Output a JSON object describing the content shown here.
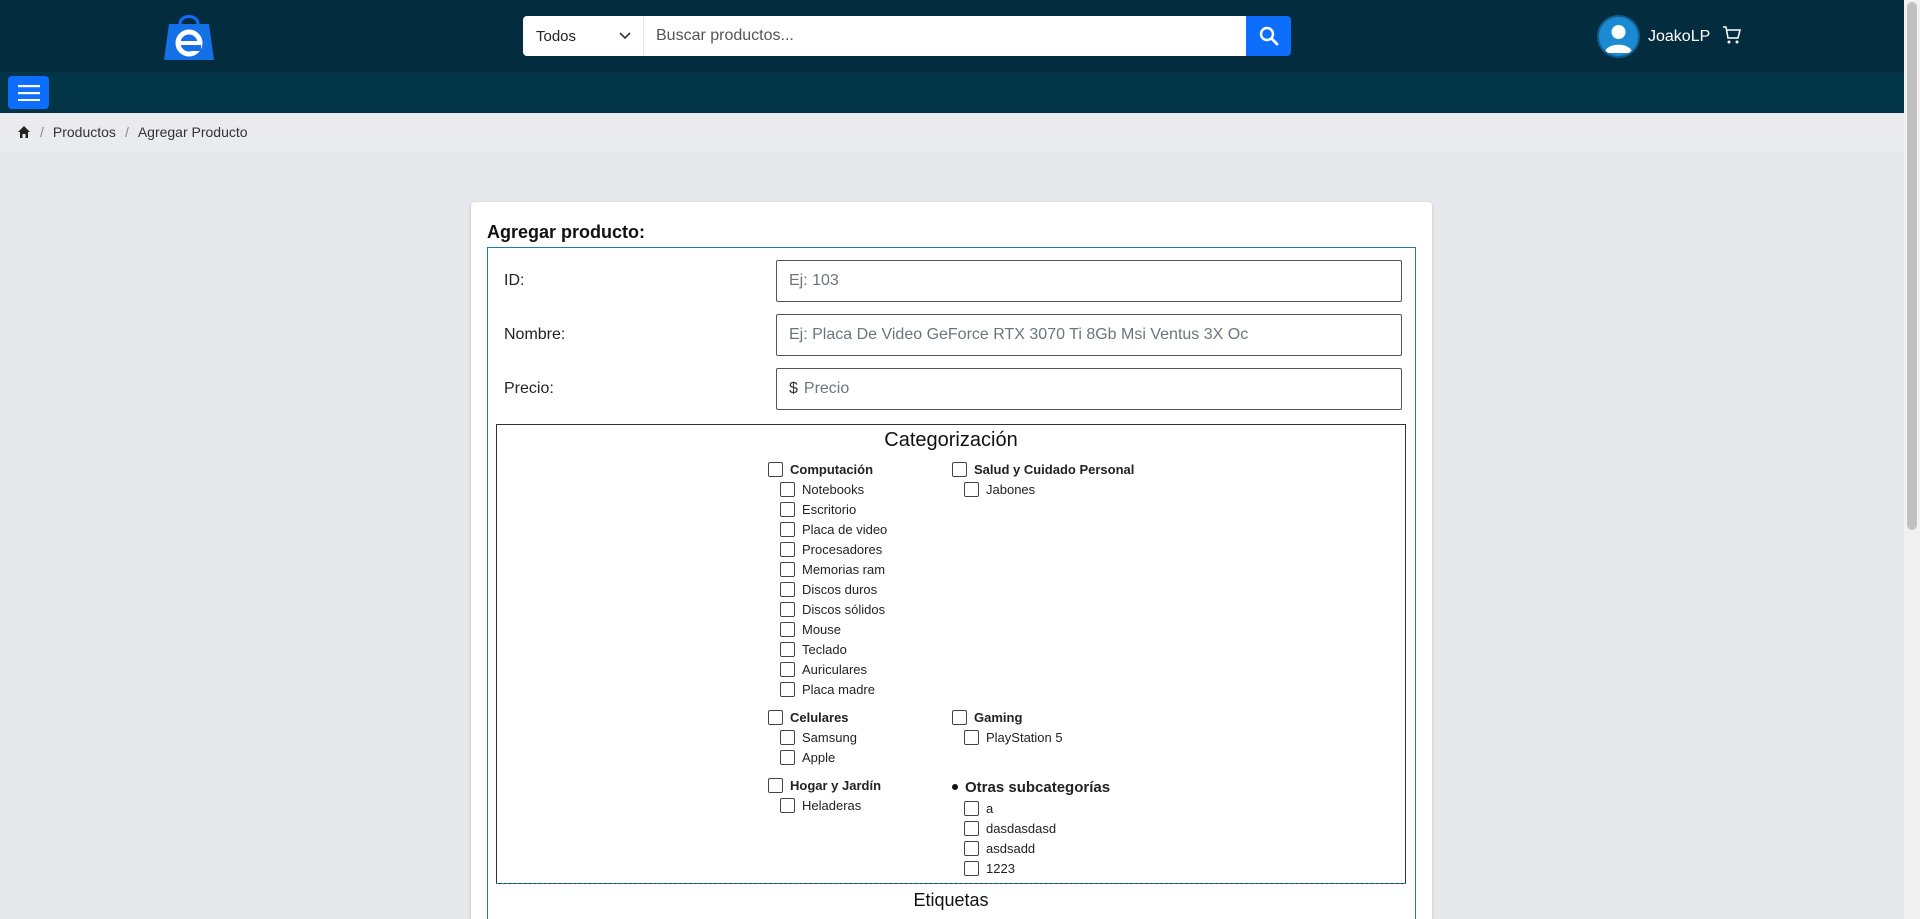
{
  "header": {
    "search_category": "Todos",
    "search_placeholder": "Buscar productos...",
    "username": "JoakoLP"
  },
  "breadcrumb": {
    "items": [
      "Productos",
      "Agregar Producto"
    ]
  },
  "form": {
    "title": "Agregar producto:",
    "id_label": "ID:",
    "id_placeholder": "Ej: 103",
    "name_label": "Nombre:",
    "name_placeholder": "Ej: Placa De Video GeForce RTX 3070 Ti 8Gb Msi Ventus 3X Oc",
    "price_label": "Precio:",
    "price_prefix": "$",
    "price_placeholder": "Precio",
    "categorization_title": "Categorización",
    "tags_title": "Etiquetas"
  },
  "categories": {
    "computacion": {
      "label": "Computación",
      "children": [
        "Notebooks",
        "Escritorio",
        "Placa de video",
        "Procesadores",
        "Memorias ram",
        "Discos duros",
        "Discos sólidos",
        "Mouse",
        "Teclado",
        "Auriculares",
        "Placa madre"
      ]
    },
    "salud": {
      "label": "Salud y Cuidado Personal",
      "children": [
        "Jabones"
      ]
    },
    "celulares": {
      "label": "Celulares",
      "children": [
        "Samsung",
        "Apple"
      ]
    },
    "gaming": {
      "label": "Gaming",
      "children": [
        "PlayStation 5"
      ]
    },
    "hogar": {
      "label": "Hogar y Jardín",
      "children": [
        "Heladeras"
      ]
    },
    "otras": {
      "label": "Otras subcategorías",
      "children": [
        "a",
        "dasdasdasd",
        "asdsadd",
        "1223"
      ]
    }
  },
  "colors": {
    "header_bg": "#042c3f",
    "nav_bg": "#023547",
    "accent": "#0d6efd"
  }
}
